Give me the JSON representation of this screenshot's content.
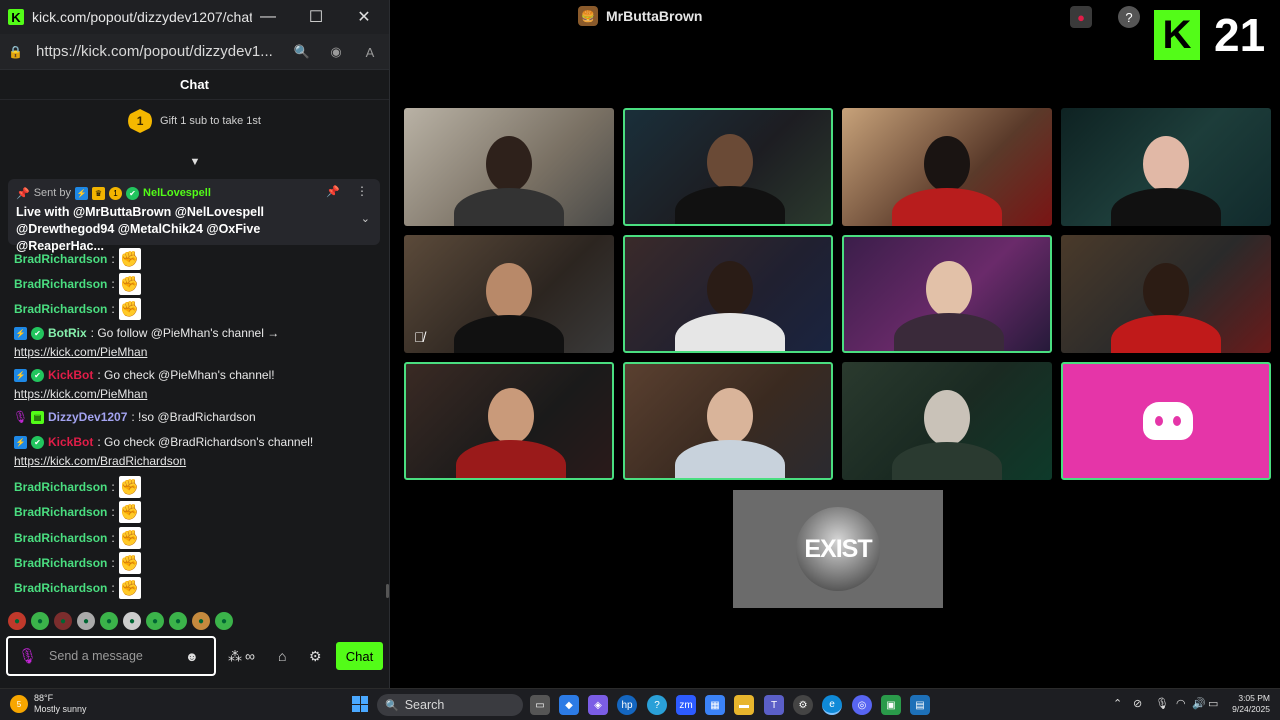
{
  "popout": {
    "title": "kick.com/popout/dizzydev1207/chat...",
    "url": "https://kick.com/popout/dizzydev1...",
    "chat_header": "Chat",
    "gift": {
      "rank": "1",
      "text": "Gift 1 sub to take 1st"
    },
    "pinned": {
      "sent_by_label": "Sent by",
      "sender": "NelLovespell",
      "message": "Live with @MrButtaBrown @NelLovespell @Drewthegod94 @MetalChik24 @OxFive @ReaperHac..."
    },
    "messages": [
      {
        "user": "BradRichardson",
        "type": "emote",
        "color": "#4ade80"
      },
      {
        "user": "BradRichardson",
        "type": "emote",
        "color": "#4ade80"
      },
      {
        "user": "BradRichardson",
        "type": "emote",
        "color": "#4ade80"
      },
      {
        "user": "BotRix",
        "text": ": Go follow @PieMhan's channel →",
        "link": "https://kick.com/PieMhan"
      },
      {
        "user": "KickBot",
        "text": ": Go check @PieMhan's channel!",
        "link": "https://kick.com/PieMhan"
      },
      {
        "user": "DizzyDev1207",
        "text": ": !so @BradRichardson"
      },
      {
        "user": "KickBot",
        "text": ": Go check @BradRichardson's channel!",
        "link": "https://kick.com/BradRichardson"
      },
      {
        "user": "BradRichardson",
        "type": "emote",
        "color": "#4ade80"
      },
      {
        "user": "BradRichardson",
        "type": "emote",
        "color": "#4ade80"
      },
      {
        "user": "BradRichardson",
        "type": "emote",
        "color": "#4ade80"
      },
      {
        "user": "BradRichardson",
        "type": "emote",
        "color": "#4ade80"
      },
      {
        "user": "BradRichardson",
        "type": "emote",
        "color": "#4ade80"
      }
    ],
    "input_placeholder": "Send a message",
    "chat_button": "Chat"
  },
  "stream": {
    "streamer_name": "MrButtaBrown",
    "kick_count": "21",
    "brand_color": "#53fc18",
    "exist_logo_text": "EXIST"
  },
  "taskbar": {
    "weather_badge": "5",
    "temp": "88°F",
    "condition": "Mostly sunny",
    "search_text": "Search",
    "time": "3:05 PM",
    "date": "9/24/2025"
  }
}
